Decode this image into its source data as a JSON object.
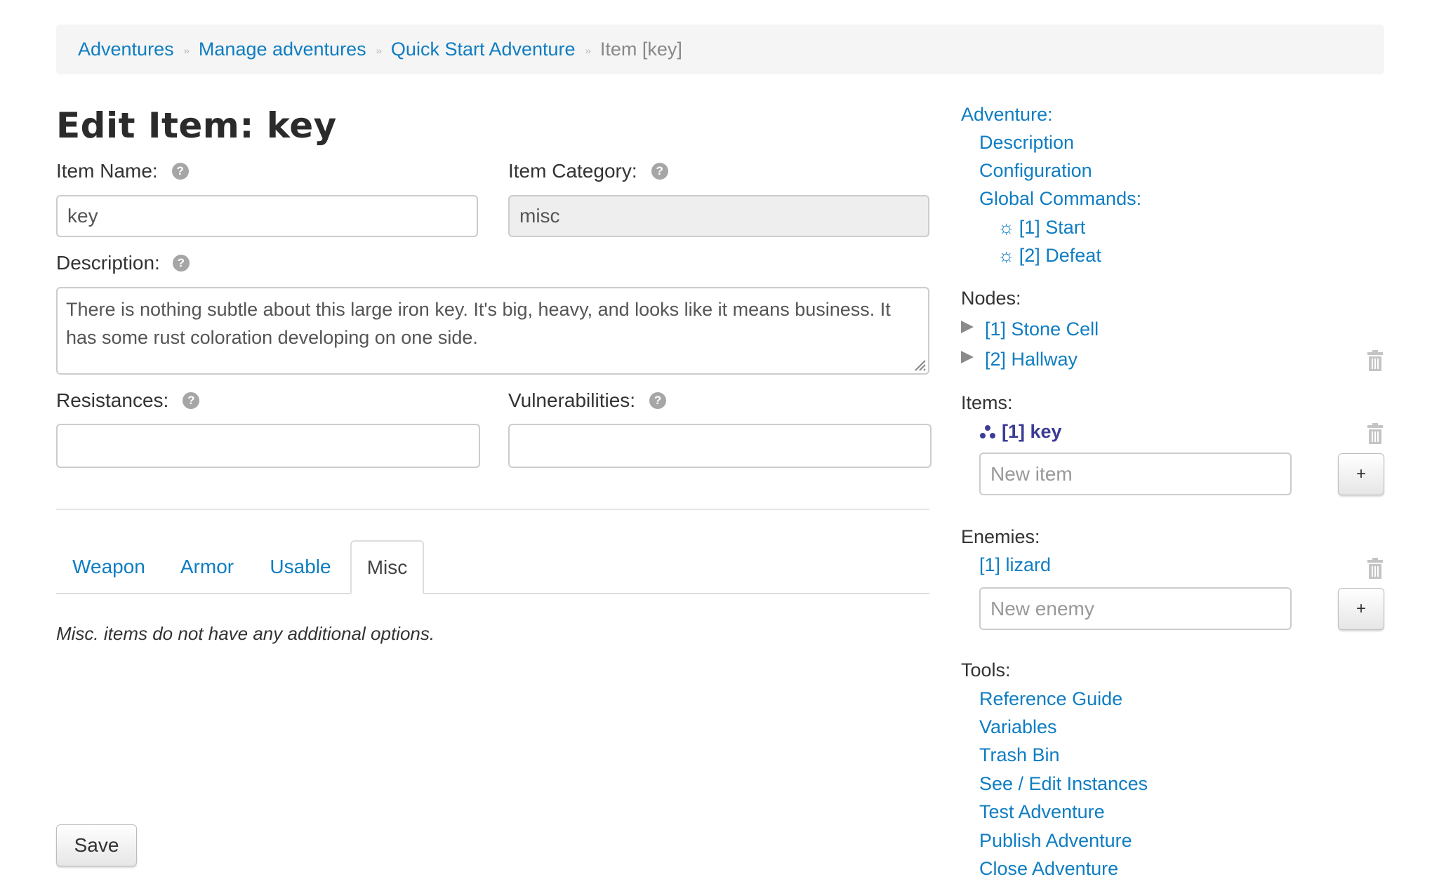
{
  "breadcrumb": {
    "items": [
      "Adventures",
      "Manage adventures",
      "Quick Start Adventure"
    ],
    "current": "Item [key]"
  },
  "page_title": "Edit Item: key",
  "form": {
    "item_name_label": "Item Name:",
    "item_name_value": "key",
    "item_category_label": "Item Category:",
    "item_category_value": "misc",
    "description_label": "Description:",
    "description_value": "There is nothing subtle about this large iron key. It's big, heavy, and looks like it means business. It has some rust coloration developing on one side.",
    "resistances_label": "Resistances:",
    "resistances_value": "",
    "vulnerabilities_label": "Vulnerabilities:",
    "vulnerabilities_value": ""
  },
  "tabs": [
    "Weapon",
    "Armor",
    "Usable",
    "Misc"
  ],
  "active_tab": "Misc",
  "tab_note": "Misc. items do not have any additional options.",
  "save_label": "Save",
  "sidebar": {
    "adventure_heading": "Adventure:",
    "description_link": "Description",
    "configuration_link": "Configuration",
    "global_commands_link": "Global Commands:",
    "commands": [
      "[1] Start",
      "[2] Defeat"
    ],
    "nodes_heading": "Nodes:",
    "nodes": [
      "[1] Stone Cell",
      "[2] Hallway"
    ],
    "items_heading": "Items:",
    "items": [
      "[1] key"
    ],
    "new_item_placeholder": "New item",
    "enemies_heading": "Enemies:",
    "enemies": [
      "[1] lizard"
    ],
    "new_enemy_placeholder": "New enemy",
    "add_label": "+",
    "tools_heading": "Tools:",
    "tools": [
      "Reference Guide",
      "Variables",
      "Trash Bin",
      "See / Edit Instances",
      "Test Adventure",
      "Publish Adventure",
      "Close Adventure"
    ]
  },
  "colors": {
    "link": "#0f7dc2",
    "active_item": "#3c3c96",
    "breadcrumb_bg": "#f5f5f5",
    "disabled_input_bg": "#eeeeee"
  }
}
